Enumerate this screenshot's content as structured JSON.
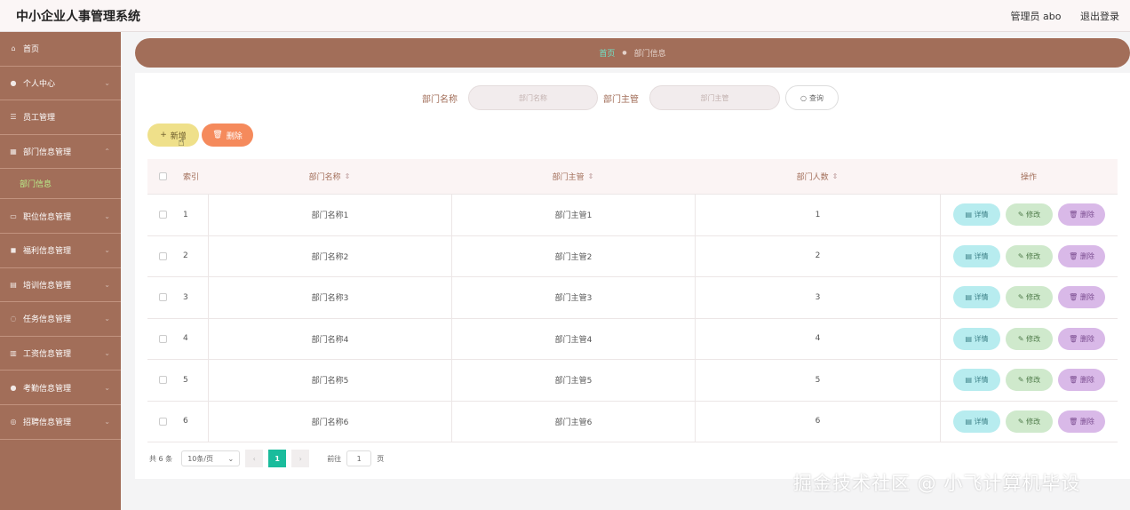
{
  "header": {
    "title": "中小企业人事管理系统",
    "user_label": "管理员 abo",
    "logout_label": "退出登录"
  },
  "sidebar": {
    "items": [
      {
        "label": "首页",
        "icon": "home-icon"
      },
      {
        "label": "个人中心",
        "icon": "user-icon"
      },
      {
        "label": "员工管理",
        "icon": "list-icon"
      },
      {
        "label": "部门信息管理",
        "icon": "grid-icon"
      },
      {
        "label": "职位信息管理",
        "icon": "card-icon"
      },
      {
        "label": "福利信息管理",
        "icon": "gift-icon"
      },
      {
        "label": "培训信息管理",
        "icon": "book-icon"
      },
      {
        "label": "任务信息管理",
        "icon": "task-icon"
      },
      {
        "label": "工资信息管理",
        "icon": "chart-icon"
      },
      {
        "label": "考勤信息管理",
        "icon": "person-icon"
      },
      {
        "label": "招聘信息管理",
        "icon": "recruit-icon"
      }
    ],
    "sub_item": "部门信息"
  },
  "breadcrumb": {
    "home": "首页",
    "current": "部门信息"
  },
  "search": {
    "dept_name_label": "部门名称",
    "dept_name_placeholder": "部门名称",
    "dept_manager_label": "部门主管",
    "dept_manager_placeholder": "部门主管",
    "query_label": "查询"
  },
  "actions": {
    "add_label": "新增",
    "delete_label": "删除"
  },
  "table": {
    "headers": {
      "index": "索引",
      "name": "部门名称",
      "manager": "部门主管",
      "count": "部门人数",
      "ops": "操作"
    },
    "ops": {
      "detail": "详情",
      "edit": "修改",
      "remove": "删除"
    },
    "rows": [
      {
        "index": "1",
        "name": "部门名称1",
        "manager": "部门主管1",
        "count": "1"
      },
      {
        "index": "2",
        "name": "部门名称2",
        "manager": "部门主管2",
        "count": "2"
      },
      {
        "index": "3",
        "name": "部门名称3",
        "manager": "部门主管3",
        "count": "3"
      },
      {
        "index": "4",
        "name": "部门名称4",
        "manager": "部门主管4",
        "count": "4"
      },
      {
        "index": "5",
        "name": "部门名称5",
        "manager": "部门主管5",
        "count": "5"
      },
      {
        "index": "6",
        "name": "部门名称6",
        "manager": "部门主管6",
        "count": "6"
      }
    ]
  },
  "pagination": {
    "total": "共 6 条",
    "page_size": "10条/页",
    "current_page": "1",
    "goto_label": "前往",
    "goto_value": "1",
    "page_suffix": "页"
  },
  "watermark": "掘金技术社区 @ 小飞计算机毕设",
  "colors": {
    "primary": "#a26e59",
    "active_page": "#1abc9c",
    "add": "#efe08a",
    "delete": "#f58a5c"
  }
}
